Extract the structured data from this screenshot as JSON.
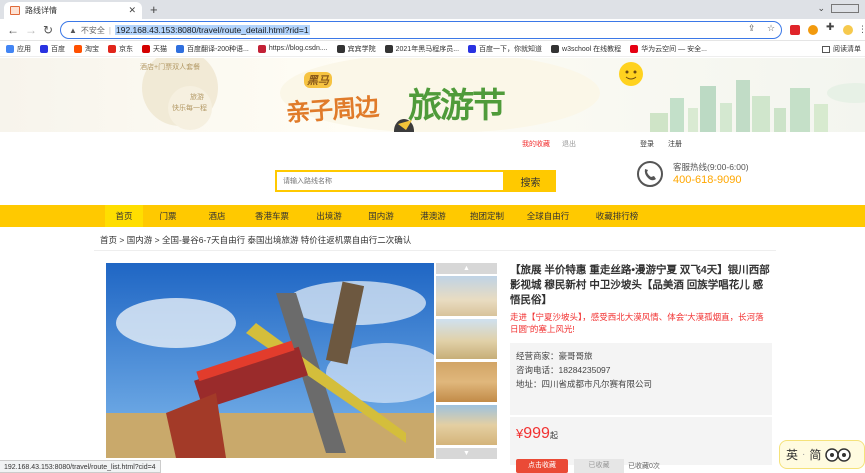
{
  "browser": {
    "tab_title": "路线详情",
    "url_insecure_label": "不安全",
    "url": "192.168.43.153:8080/travel/route_detail.html?rid=1",
    "status_url": "192.168.43.153:8080/travel/route_list.html?cid=4"
  },
  "bookmarks": [
    {
      "label": "应用",
      "color": "#4285f4"
    },
    {
      "label": "百度",
      "color": "#2932e1"
    },
    {
      "label": "淘宝",
      "color": "#ff5000"
    },
    {
      "label": "京东",
      "color": "#e1251b"
    },
    {
      "label": "天猫",
      "color": "#d40000"
    },
    {
      "label": "百度翻译-200种语...",
      "color": "#2f6fde"
    },
    {
      "label": "https://blog.csdn....",
      "color": "#c32136"
    },
    {
      "label": "宾宾学院",
      "color": "#333333"
    },
    {
      "label": "2021年黑马程序员...",
      "color": "#333333"
    },
    {
      "label": "百度一下，你就知道",
      "color": "#2932e1"
    },
    {
      "label": "w3school 在线教程",
      "color": "#333333"
    },
    {
      "label": "华为云空间 — 安全...",
      "color": "#e60012"
    }
  ],
  "bookmarks_right": "阅读清单",
  "banner": {
    "stamp_line1": "酒店+门票双人套餐",
    "stamp_line2": "旅游",
    "stamp_line3": "快乐每一程",
    "brand_small": "黑马",
    "brand_big1": "亲子周边",
    "brand_big2": "旅游节"
  },
  "header": {
    "my_fav": "我的收藏",
    "logout": "退出",
    "login": "登录",
    "register": "注册",
    "search_placeholder": "请输入路线名称",
    "search_button": "搜索",
    "hotline_label": "客服热线(9:00-6:00)",
    "hotline_number": "400-618-9090"
  },
  "menu": [
    {
      "label": "首页",
      "active": true
    },
    {
      "label": "门票",
      "active": false
    },
    {
      "label": "酒店",
      "active": false
    },
    {
      "label": "香港车票",
      "active": false
    },
    {
      "label": "出境游",
      "active": false
    },
    {
      "label": "国内游",
      "active": false
    },
    {
      "label": "港澳游",
      "active": false
    },
    {
      "label": "抱团定制",
      "active": false
    },
    {
      "label": "全球自由行",
      "active": false
    },
    {
      "label": "收藏排行榜",
      "active": false
    }
  ],
  "breadcrumb": {
    "home": "首页",
    "sep": ">",
    "category": "国内游",
    "current": "全国-曼谷6-7天自由行 泰国出境旅游 特价往返机票自由行二次确认"
  },
  "route": {
    "title": "【旅展 半价特惠 重走丝路•漫游宁夏 双飞4天】银川西部影视城 穆民新村 中卫沙坡头【品美酒 回族学唱花儿 感悟民俗】",
    "subtitle": "走进【宁夏沙坡头】，感受西北大漠风情、体会“大漠孤烟直，长河落日圆”的塞上风光!",
    "seller_label": "经营商家：",
    "seller_name": "豪哥哥旅",
    "phone_label": "咨询电话：",
    "phone": "18284235097",
    "address_label": "地址：",
    "address": "四川省成都市凡尔赛有限公司",
    "price_symbol": "¥",
    "price": "999",
    "price_suffix": "起",
    "fav_button": "点击收藏",
    "fav_disabled": "已收藏",
    "fav_count_label": "已收藏0次"
  },
  "ime": {
    "mode": "英",
    "sep": "·",
    "char": "简"
  },
  "colors": {
    "brand_yellow": "#ffc900",
    "price_red": "#f23030",
    "hotline_orange": "#ffa700"
  }
}
